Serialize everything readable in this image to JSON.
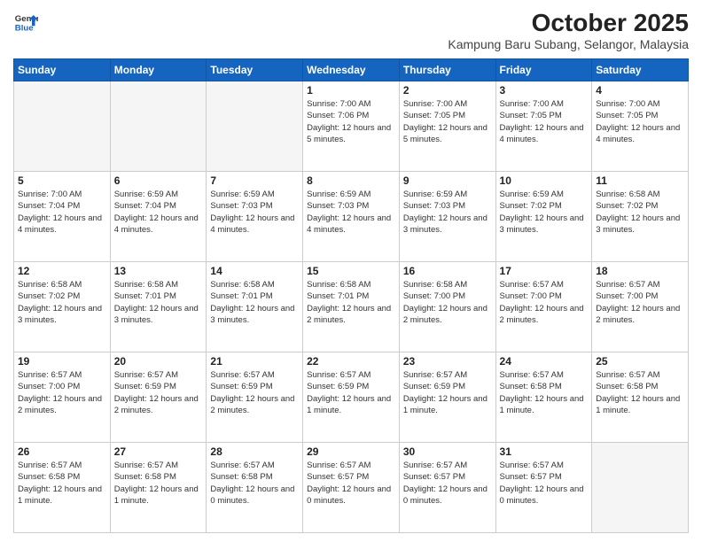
{
  "logo": {
    "line1": "General",
    "line2": "Blue"
  },
  "title": "October 2025",
  "subtitle": "Kampung Baru Subang, Selangor, Malaysia",
  "headers": [
    "Sunday",
    "Monday",
    "Tuesday",
    "Wednesday",
    "Thursday",
    "Friday",
    "Saturday"
  ],
  "weeks": [
    [
      {
        "day": "",
        "info": ""
      },
      {
        "day": "",
        "info": ""
      },
      {
        "day": "",
        "info": ""
      },
      {
        "day": "1",
        "sunrise": "7:00 AM",
        "sunset": "7:06 PM",
        "daylight": "12 hours and 5 minutes."
      },
      {
        "day": "2",
        "sunrise": "7:00 AM",
        "sunset": "7:05 PM",
        "daylight": "12 hours and 5 minutes."
      },
      {
        "day": "3",
        "sunrise": "7:00 AM",
        "sunset": "7:05 PM",
        "daylight": "12 hours and 4 minutes."
      },
      {
        "day": "4",
        "sunrise": "7:00 AM",
        "sunset": "7:05 PM",
        "daylight": "12 hours and 4 minutes."
      }
    ],
    [
      {
        "day": "5",
        "sunrise": "7:00 AM",
        "sunset": "7:04 PM",
        "daylight": "12 hours and 4 minutes."
      },
      {
        "day": "6",
        "sunrise": "6:59 AM",
        "sunset": "7:04 PM",
        "daylight": "12 hours and 4 minutes."
      },
      {
        "day": "7",
        "sunrise": "6:59 AM",
        "sunset": "7:03 PM",
        "daylight": "12 hours and 4 minutes."
      },
      {
        "day": "8",
        "sunrise": "6:59 AM",
        "sunset": "7:03 PM",
        "daylight": "12 hours and 4 minutes."
      },
      {
        "day": "9",
        "sunrise": "6:59 AM",
        "sunset": "7:03 PM",
        "daylight": "12 hours and 3 minutes."
      },
      {
        "day": "10",
        "sunrise": "6:59 AM",
        "sunset": "7:02 PM",
        "daylight": "12 hours and 3 minutes."
      },
      {
        "day": "11",
        "sunrise": "6:58 AM",
        "sunset": "7:02 PM",
        "daylight": "12 hours and 3 minutes."
      }
    ],
    [
      {
        "day": "12",
        "sunrise": "6:58 AM",
        "sunset": "7:02 PM",
        "daylight": "12 hours and 3 minutes."
      },
      {
        "day": "13",
        "sunrise": "6:58 AM",
        "sunset": "7:01 PM",
        "daylight": "12 hours and 3 minutes."
      },
      {
        "day": "14",
        "sunrise": "6:58 AM",
        "sunset": "7:01 PM",
        "daylight": "12 hours and 3 minutes."
      },
      {
        "day": "15",
        "sunrise": "6:58 AM",
        "sunset": "7:01 PM",
        "daylight": "12 hours and 2 minutes."
      },
      {
        "day": "16",
        "sunrise": "6:58 AM",
        "sunset": "7:00 PM",
        "daylight": "12 hours and 2 minutes."
      },
      {
        "day": "17",
        "sunrise": "6:57 AM",
        "sunset": "7:00 PM",
        "daylight": "12 hours and 2 minutes."
      },
      {
        "day": "18",
        "sunrise": "6:57 AM",
        "sunset": "7:00 PM",
        "daylight": "12 hours and 2 minutes."
      }
    ],
    [
      {
        "day": "19",
        "sunrise": "6:57 AM",
        "sunset": "7:00 PM",
        "daylight": "12 hours and 2 minutes."
      },
      {
        "day": "20",
        "sunrise": "6:57 AM",
        "sunset": "6:59 PM",
        "daylight": "12 hours and 2 minutes."
      },
      {
        "day": "21",
        "sunrise": "6:57 AM",
        "sunset": "6:59 PM",
        "daylight": "12 hours and 2 minutes."
      },
      {
        "day": "22",
        "sunrise": "6:57 AM",
        "sunset": "6:59 PM",
        "daylight": "12 hours and 1 minute."
      },
      {
        "day": "23",
        "sunrise": "6:57 AM",
        "sunset": "6:59 PM",
        "daylight": "12 hours and 1 minute."
      },
      {
        "day": "24",
        "sunrise": "6:57 AM",
        "sunset": "6:58 PM",
        "daylight": "12 hours and 1 minute."
      },
      {
        "day": "25",
        "sunrise": "6:57 AM",
        "sunset": "6:58 PM",
        "daylight": "12 hours and 1 minute."
      }
    ],
    [
      {
        "day": "26",
        "sunrise": "6:57 AM",
        "sunset": "6:58 PM",
        "daylight": "12 hours and 1 minute."
      },
      {
        "day": "27",
        "sunrise": "6:57 AM",
        "sunset": "6:58 PM",
        "daylight": "12 hours and 1 minute."
      },
      {
        "day": "28",
        "sunrise": "6:57 AM",
        "sunset": "6:58 PM",
        "daylight": "12 hours and 0 minutes."
      },
      {
        "day": "29",
        "sunrise": "6:57 AM",
        "sunset": "6:57 PM",
        "daylight": "12 hours and 0 minutes."
      },
      {
        "day": "30",
        "sunrise": "6:57 AM",
        "sunset": "6:57 PM",
        "daylight": "12 hours and 0 minutes."
      },
      {
        "day": "31",
        "sunrise": "6:57 AM",
        "sunset": "6:57 PM",
        "daylight": "12 hours and 0 minutes."
      },
      {
        "day": "",
        "info": ""
      }
    ]
  ]
}
